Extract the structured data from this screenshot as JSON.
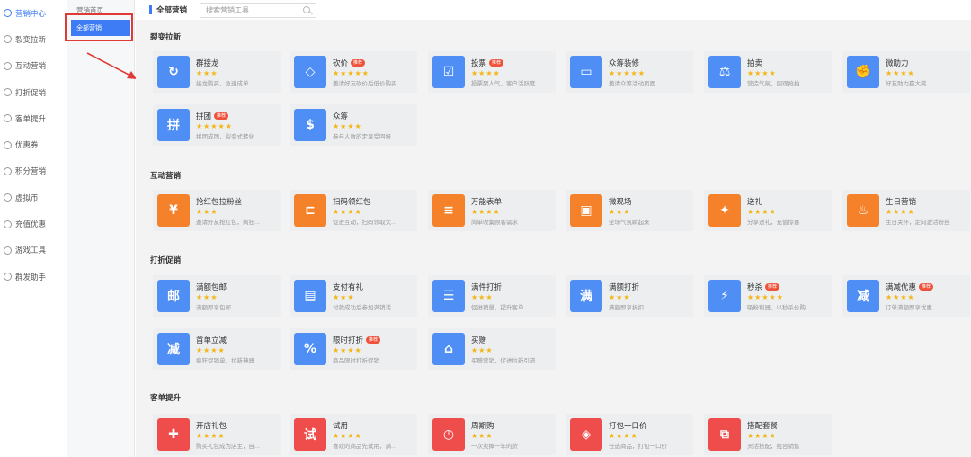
{
  "sidebar": {
    "items": [
      {
        "label": "营销中心",
        "active": true
      },
      {
        "label": "裂变拉新"
      },
      {
        "label": "互动营销"
      },
      {
        "label": "打折促销"
      },
      {
        "label": "客单提升"
      },
      {
        "label": "优惠券"
      },
      {
        "label": "积分营销"
      },
      {
        "label": "虚拟币"
      },
      {
        "label": "充值优惠"
      },
      {
        "label": "游戏工具"
      },
      {
        "label": "群发助手"
      }
    ]
  },
  "submenu": {
    "home": "营销首页",
    "active": "全部营销"
  },
  "topbar": {
    "title": "全部营销",
    "search_placeholder": "搜索营销工具"
  },
  "sections": [
    {
      "title": "裂变拉新",
      "cards": [
        {
          "name": "群接龙",
          "desc": "接龙购买，急速成单",
          "stars": 3,
          "icon": "link-icon",
          "color": "blue"
        },
        {
          "name": "砍价",
          "desc": "邀请好友砍价后低价购买",
          "stars": 5,
          "hot": "推荐",
          "icon": "tag-icon",
          "color": "blue"
        },
        {
          "name": "投票",
          "desc": "投票聚人气，客户活跃度",
          "stars": 4,
          "hot": "推荐",
          "icon": "vote-icon",
          "color": "blue"
        },
        {
          "name": "众筹装修",
          "desc": "邀请众筹活动页面",
          "stars": 5,
          "icon": "roller-icon",
          "color": "blue"
        },
        {
          "name": "拍卖",
          "desc": "营造气氛，围观抢拍",
          "stars": 4,
          "icon": "gavel-icon",
          "color": "blue"
        },
        {
          "name": "微助力",
          "desc": "好友助力赢大奖",
          "stars": 4,
          "icon": "fist-icon",
          "color": "blue"
        },
        {
          "name": "拼团",
          "desc": "拼团成团，裂变式转化",
          "stars": 5,
          "hot": "推荐",
          "icon": "group-buy-icon",
          "color": "blue"
        },
        {
          "name": "众筹",
          "desc": "参与人数的定享受回报",
          "stars": 4,
          "icon": "dollar-hand-icon",
          "color": "blue"
        }
      ]
    },
    {
      "title": "互动营销",
      "cards": [
        {
          "name": "抢红包拉粉丝",
          "desc": "邀请好友抢红包，病狂...",
          "stars": 3,
          "icon": "red-packet-icon",
          "color": "orange"
        },
        {
          "name": "扫码领红包",
          "desc": "促进互动，扫码领取大...",
          "stars": 4,
          "icon": "scan-icon",
          "color": "orange"
        },
        {
          "name": "万能表单",
          "desc": "简单收集顾客需求",
          "stars": 4,
          "icon": "form-icon",
          "color": "orange"
        },
        {
          "name": "微现场",
          "desc": "全场气氛瞬起来",
          "stars": 3,
          "icon": "screen-icon",
          "color": "orange"
        },
        {
          "name": "送礼",
          "desc": "分享送礼，充值惊喜",
          "stars": 4,
          "icon": "gift-icon",
          "color": "orange"
        },
        {
          "name": "生日营销",
          "desc": "生日关怀，定向激活粉丝",
          "stars": 4,
          "icon": "cake-icon",
          "color": "orange"
        }
      ]
    },
    {
      "title": "打折促销",
      "cards": [
        {
          "name": "满额包邮",
          "desc": "满额即享包邮",
          "stars": 3,
          "icon": "mail-icon",
          "color": "blue"
        },
        {
          "name": "支付有礼",
          "desc": "付款成功后参加满销活...",
          "stars": 3,
          "icon": "card-icon",
          "color": "blue"
        },
        {
          "name": "满件打折",
          "desc": "促进销量，提升客单",
          "stars": 3,
          "icon": "checklist-icon",
          "color": "blue"
        },
        {
          "name": "满额打折",
          "desc": "满额即享折扣",
          "stars": 3,
          "icon": "coupon-icon",
          "color": "blue"
        },
        {
          "name": "秒杀",
          "desc": "吸粉利器，以秒杀价购...",
          "stars": 5,
          "hot": "推荐",
          "icon": "flash-icon",
          "color": "blue"
        },
        {
          "name": "满减优惠",
          "desc": "订单满额即享优惠",
          "stars": 4,
          "hot": "推荐",
          "icon": "minus-icon",
          "color": "blue"
        },
        {
          "name": "首单立减",
          "desc": "疯狂促销单，拉新神器",
          "stars": 4,
          "icon": "first-order-icon",
          "color": "blue"
        },
        {
          "name": "限时打折",
          "desc": "商品限时打折促销",
          "stars": 4,
          "hot": "推荐",
          "icon": "percent-icon",
          "color": "blue"
        },
        {
          "name": "买赠",
          "desc": "买赠营销，促进拉新引流",
          "stars": 3,
          "icon": "gift-box-icon",
          "color": "blue"
        }
      ]
    },
    {
      "title": "客单提升",
      "cards": [
        {
          "name": "开店礼包",
          "desc": "购买礼包成为店主，自...",
          "stars": 4,
          "icon": "present-icon",
          "color": "red"
        },
        {
          "name": "试用",
          "desc": "喜欢的商品先试用，满...",
          "stars": 4,
          "icon": "bag-icon",
          "color": "red"
        },
        {
          "name": "周期购",
          "desc": "一次卖掉一年的货",
          "stars": 3,
          "icon": "clock-icon",
          "color": "red"
        },
        {
          "name": "打包一口价",
          "desc": "任选商品，打包一口价",
          "stars": 4,
          "icon": "package-icon",
          "color": "red"
        },
        {
          "name": "搭配套餐",
          "desc": "灵活搭配，组合销售",
          "stars": 4,
          "icon": "combo-icon",
          "color": "red"
        }
      ]
    }
  ],
  "colors": {
    "blue": "#4e8ef5",
    "orange": "#f5822a",
    "red": "#ef4c4c",
    "accent": "#3d7cf4",
    "highlight_border": "#e03a36",
    "star": "#f5b40f"
  }
}
